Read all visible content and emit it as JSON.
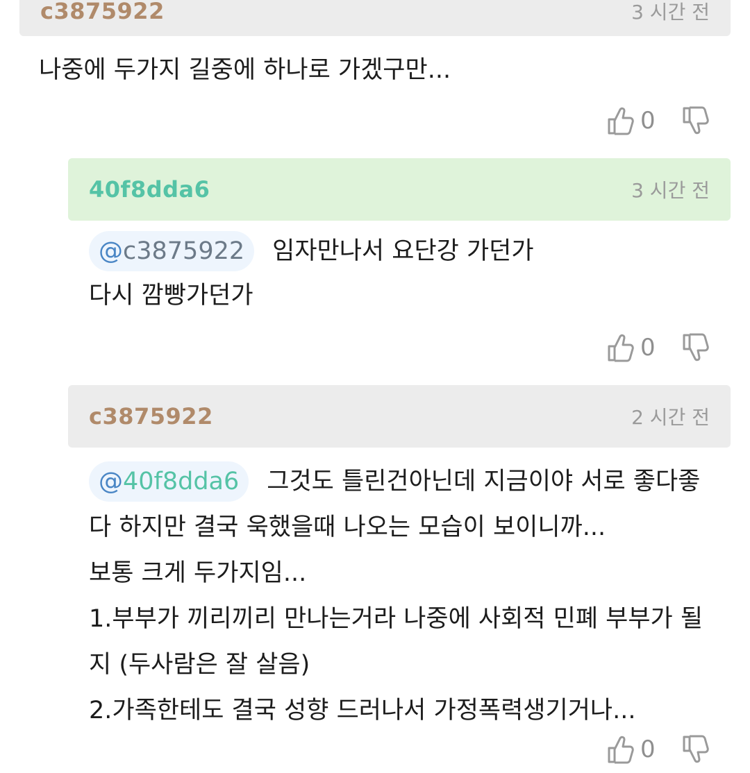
{
  "comments": [
    {
      "user": "c3875922",
      "time": "3 시간 전",
      "text": "나중에 두가지 길중에 하나로 가겠구만...",
      "likes": "0"
    },
    {
      "user": "40f8dda6",
      "time": "3 시간 전",
      "mention": {
        "at": "@",
        "name": "c3875922"
      },
      "lines": [
        "임자만나서 요단강 가던가",
        "다시 깜빵가던가"
      ],
      "likes": "0"
    },
    {
      "user": "c3875922",
      "time": "2 시간 전",
      "mention": {
        "at": "@",
        "name": "40f8dda6"
      },
      "lines": [
        "그것도 틀린건아닌데 지금이야 서로 좋다좋",
        "다 하지만 결국 욱했을때 나오는 모습이 보이니까...",
        "보통 크게 두가지임...",
        "1.부부가 끼리끼리 만나는거라 나중에 사회적 민폐 부부가 될",
        "지 (두사람은 잘 살음)",
        "2.가족한테도 결국 성향 드러나서 가정폭력생기거나..."
      ],
      "likes": "0"
    }
  ],
  "colors": {
    "header_gray": "#ececec",
    "header_green": "#dff3da",
    "username_brown": "#b08a6a",
    "username_teal": "#55c3a6",
    "mention_bg": "#eef5fd"
  },
  "icons": [
    "thumbs-up-icon",
    "thumbs-down-icon"
  ]
}
